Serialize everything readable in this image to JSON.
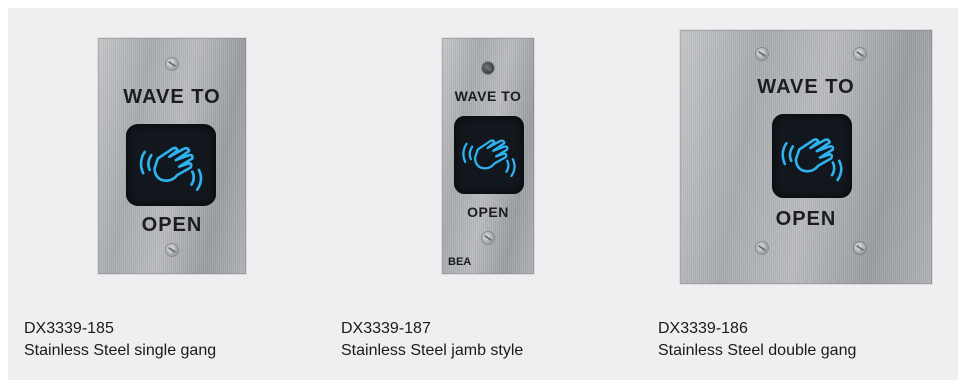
{
  "products": [
    {
      "plate_text_top": "WAVE TO",
      "plate_text_bottom": "OPEN",
      "model": "DX3339-185",
      "description": "Stainless Steel single gang"
    },
    {
      "plate_text_top": "WAVE TO",
      "plate_text_bottom": "OPEN",
      "brand": "BEA",
      "model": "DX3339-187",
      "description": "Stainless Steel jamb style"
    },
    {
      "plate_text_top": "WAVE TO",
      "plate_text_bottom": "OPEN",
      "model": "DX3339-186",
      "description": "Stainless Steel double gang"
    }
  ],
  "colors": {
    "panel_bg": "#efeff1",
    "sensor_bg": "#12161d",
    "hand_glow": "#2fb3f0",
    "text": "#1a1a1a"
  },
  "icons": [
    "hand-wave-icon",
    "screw-icon"
  ]
}
